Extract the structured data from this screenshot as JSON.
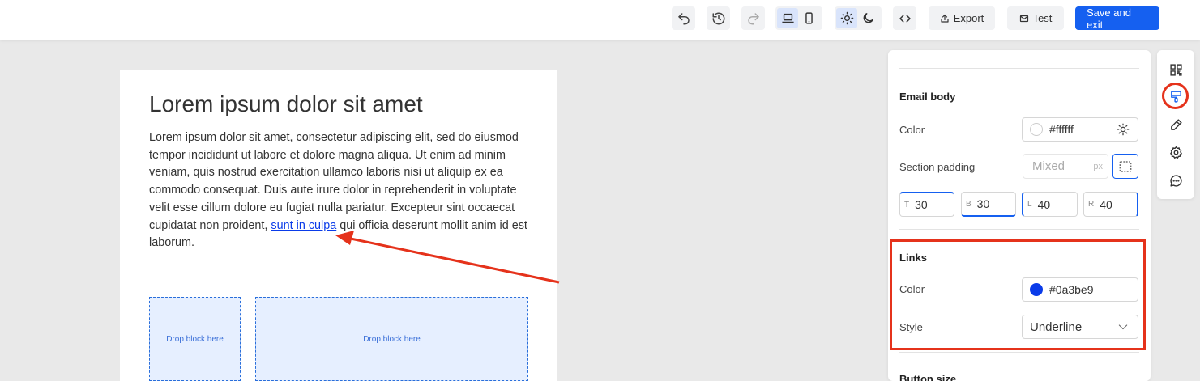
{
  "toolbar": {
    "undo": "undo-icon",
    "history": "history-icon",
    "redo": "redo-icon",
    "export_label": "Export",
    "test_label": "Test",
    "save_label": "Save and exit"
  },
  "email": {
    "heading": "Lorem ipsum dolor sit amet",
    "body_before_link": "Lorem ipsum dolor sit amet, consectetur adipiscing elit, sed do eiusmod tempor incididunt ut labore et dolore magna aliqua. Ut enim ad minim veniam, quis nostrud exercitation ullamco laboris nisi ut aliquip ex ea commodo consequat. Duis aute irure dolor in reprehenderit in voluptate velit esse cillum dolore eu fugiat nulla pariatur. Excepteur sint occaecat cupidatat non proident, ",
    "link_text": "sunt in culpa",
    "body_after_link": " qui officia deserunt mollit anim id est laborum.",
    "drop_left": "Drop block here",
    "drop_right": "Drop block here"
  },
  "panel": {
    "email_body": {
      "title": "Email body",
      "color_label": "Color",
      "color_value": "#ffffff",
      "section_padding_label": "Section padding",
      "padding_placeholder": "Mixed",
      "padding_unit": "px",
      "padding": [
        {
          "prefix": "T",
          "value": "30"
        },
        {
          "prefix": "B",
          "value": "30"
        },
        {
          "prefix": "L",
          "value": "40"
        },
        {
          "prefix": "R",
          "value": "40"
        }
      ]
    },
    "links": {
      "title": "Links",
      "color_label": "Color",
      "color_value": "#0a3be9",
      "style_label": "Style",
      "style_value": "Underline"
    },
    "button_size": {
      "title": "Button size"
    }
  },
  "colors": {
    "accent": "#1560f0",
    "link": "#0a3be9",
    "annotation": "#e5321b"
  }
}
